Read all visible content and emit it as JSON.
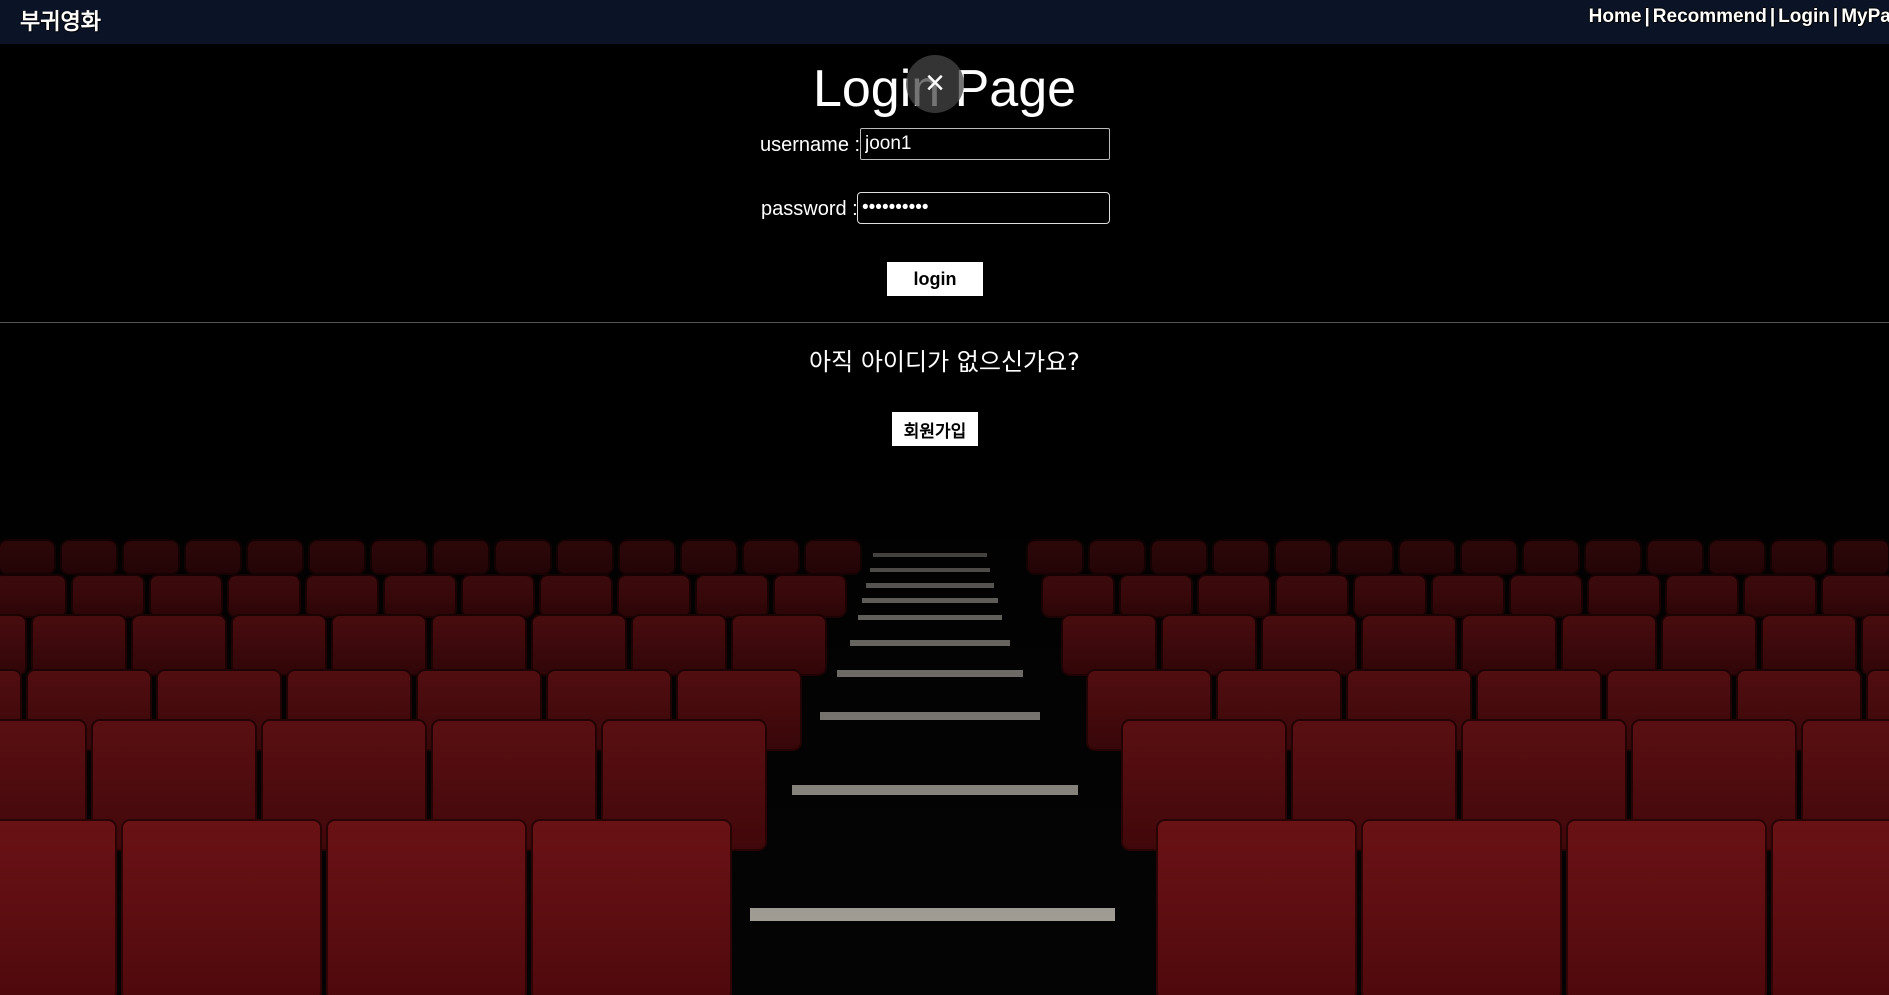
{
  "nav": {
    "brand": "부귀영화",
    "links": [
      "Home",
      "Recommend",
      "Login",
      "MyPage"
    ],
    "separator": "|"
  },
  "login": {
    "title": "Login Page",
    "username_label": "username :",
    "username_value": "joon1",
    "password_label": "password :",
    "password_value": "••••••••••",
    "submit_label": "login",
    "close_icon": "×"
  },
  "signup": {
    "prompt": "아직 아이디가 없으신가요?",
    "button_label": "회원가입"
  },
  "colors": {
    "navbar_bg": "#0b1426",
    "page_bg": "#000000",
    "seat_red": "#8a1218",
    "button_bg": "#ffffff"
  }
}
